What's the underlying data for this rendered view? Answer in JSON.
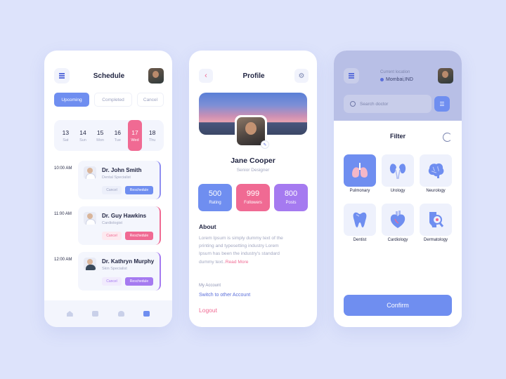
{
  "schedule": {
    "title": "Schedule",
    "tabs": [
      "Upcoming",
      "Completed",
      "Cancel"
    ],
    "days": [
      {
        "num": "13",
        "dow": "Sat"
      },
      {
        "num": "14",
        "dow": "Sun"
      },
      {
        "num": "15",
        "dow": "Mon"
      },
      {
        "num": "16",
        "dow": "Tue"
      },
      {
        "num": "17",
        "dow": "Wed"
      },
      {
        "num": "18",
        "dow": "Thu"
      }
    ],
    "appointments": [
      {
        "time": "10:00 AM",
        "name": "Dr. John Smith",
        "specialty": "Dental Specialist",
        "cancel": "Cancel",
        "reschedule": "Reschedule"
      },
      {
        "time": "11:00 AM",
        "name": "Dr. Guy Hawkins",
        "specialty": "Cardiologist",
        "cancel": "Cancel",
        "reschedule": "Reschedule"
      },
      {
        "time": "12:00 AM",
        "name": "Dr. Kathryn Murphy",
        "specialty": "Skin Specialist",
        "cancel": "Cancel",
        "reschedule": "Reschedule"
      }
    ]
  },
  "profile": {
    "title": "Profile",
    "name": "Jane Cooper",
    "role": "Senior Designer",
    "stats": [
      {
        "value": "500",
        "label": "Rating"
      },
      {
        "value": "999",
        "label": "Followers"
      },
      {
        "value": "800",
        "label": "Posts"
      }
    ],
    "about_heading": "About",
    "about_line1": "Lorem Ipsum is simply dummy text of the",
    "about_line2": "printing and typesetting industry Lorem",
    "about_line3": "Ipsum has been the industry's standard",
    "about_line4": "dummy text..",
    "read_more": "Read More",
    "account_heading": "My Account",
    "switch_account": "Switch to other Account",
    "logout": "Logout"
  },
  "filter": {
    "location_label": "Current location",
    "location_value": "Mombai,IND",
    "search_placeholder": "Search doctor",
    "title": "Filter",
    "categories": [
      "Pulmonary",
      "Urology",
      "Neurology",
      "Dentist",
      "Cardiology",
      "Dermatology"
    ],
    "confirm": "Confirm"
  },
  "colors": {
    "background": "#dde3fb",
    "primary": "#6f8ef0",
    "pink": "#f06a93",
    "violet": "#a57af0"
  }
}
